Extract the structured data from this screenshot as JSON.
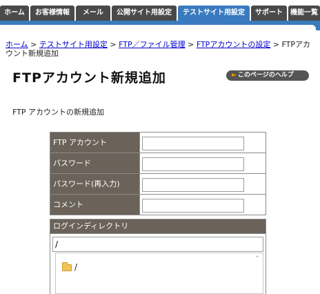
{
  "tabs": [
    {
      "label": "ホーム",
      "active": false
    },
    {
      "label": "お客様情報",
      "active": false
    },
    {
      "label": "メール",
      "active": false
    },
    {
      "label": "公開サイト用設定",
      "active": false
    },
    {
      "label": "テストサイト用設定",
      "active": true
    },
    {
      "label": "サポート",
      "active": false
    },
    {
      "label": "機能一覧",
      "active": false
    }
  ],
  "breadcrumb": {
    "items": [
      "ホーム",
      "テストサイト用設定",
      "FTP／ファイル管理",
      "FTPアカウントの設定"
    ],
    "current": "FTPアカウント新規追加",
    "separator": ">"
  },
  "page_title": "FTPアカウント新規追加",
  "help_button": "このページのヘルプ",
  "subtitle": "FTP アカウントの新規追加",
  "form": {
    "fields": [
      {
        "label": "FTP アカウント",
        "value": ""
      },
      {
        "label": "パスワード",
        "value": ""
      },
      {
        "label": "パスワード(再入力)",
        "value": ""
      },
      {
        "label": "コメント",
        "value": ""
      }
    ],
    "login_dir_label": "ログインディレクトリ",
    "login_dir_value": "/",
    "tree_root": "/"
  },
  "colors": {
    "tab_bg": "#4a4a4a",
    "tab_active": "#3a7bbf",
    "label_bg": "#6b6359",
    "link": "#0000cc",
    "help_arrow": "#f39800"
  }
}
